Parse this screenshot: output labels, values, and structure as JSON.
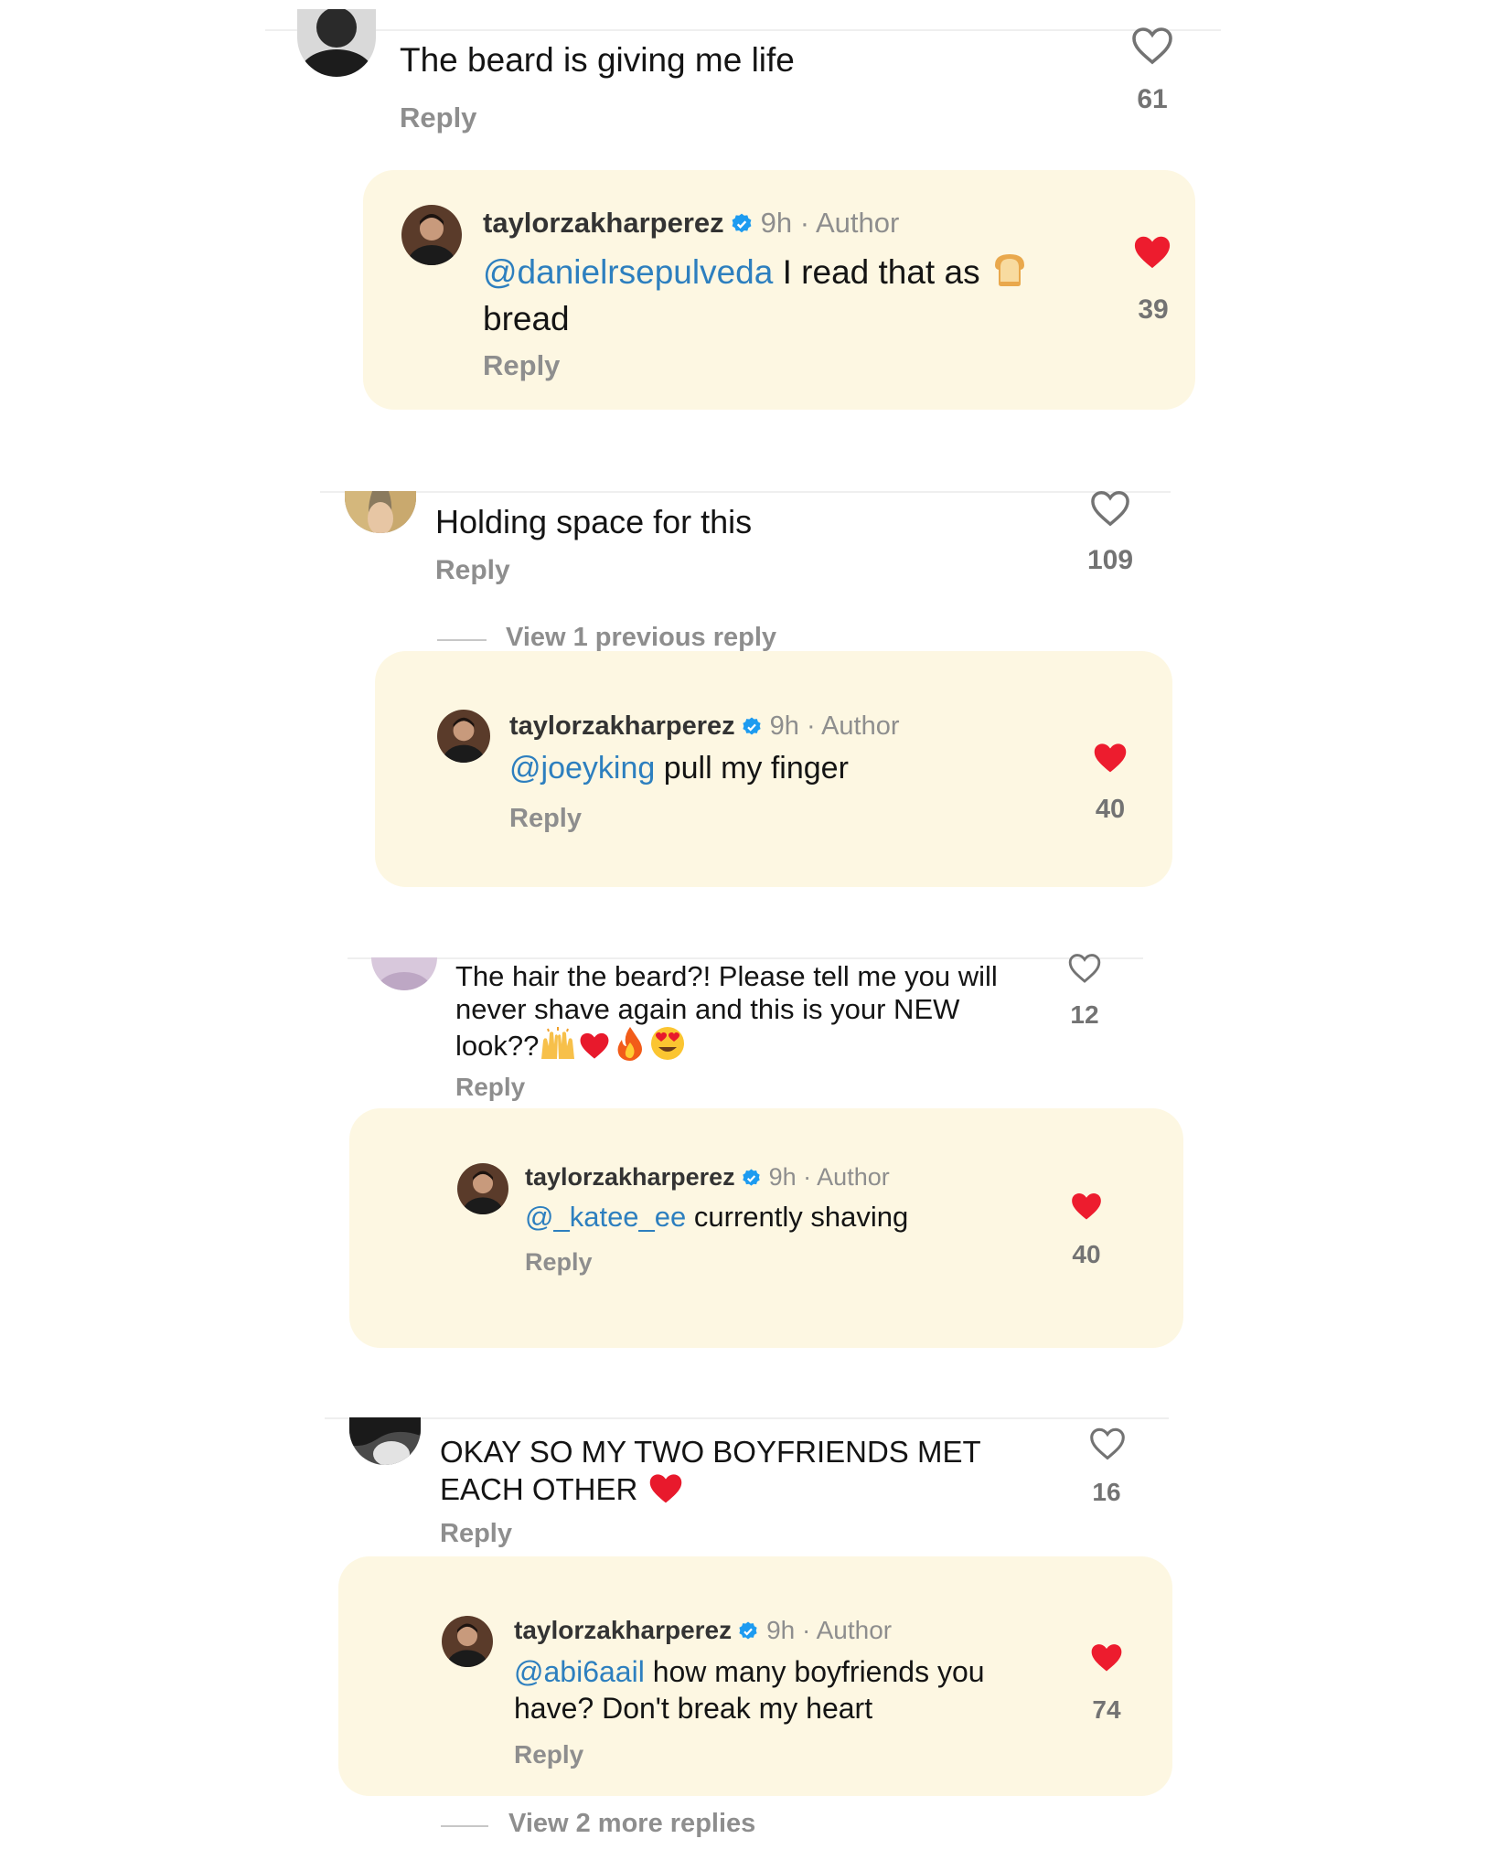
{
  "reply_label": "Reply",
  "colors": {
    "panel_bg": "#fdf7e2",
    "mention": "#2d7fbf",
    "liked_heart": "#ed1c2e",
    "verified": "#1d9bf0"
  },
  "threads": [
    {
      "comment": {
        "text": "The beard is giving me life",
        "likes": "61",
        "liked": false
      },
      "author_reply": {
        "username": "taylorzakharperez",
        "time": "9h",
        "role": "Author",
        "mention": "@danielrsepulveda",
        "text_line1": " I read that as ",
        "text_line2": "bread",
        "emoji": "bread-emoji",
        "likes": "39",
        "liked": true
      }
    },
    {
      "comment": {
        "text": "Holding space for this",
        "likes": "109",
        "liked": false
      },
      "view_previous": "View 1 previous reply",
      "author_reply": {
        "username": "taylorzakharperez",
        "time": "9h",
        "role": "Author",
        "mention": "@joeyking",
        "text": " pull my finger",
        "likes": "40",
        "liked": true
      }
    },
    {
      "comment": {
        "line1": "The hair the beard?! Please tell me you will",
        "line2": "never shave again and this is your NEW",
        "line3": "look??",
        "emojis": [
          "raising-hands-emoji",
          "red-heart-emoji",
          "fire-emoji",
          "heart-eyes-emoji"
        ],
        "likes": "12",
        "liked": false
      },
      "author_reply": {
        "username": "taylorzakharperez",
        "time": "9h",
        "role": "Author",
        "mention": "@_katee_ee",
        "text": " currently shaving",
        "likes": "40",
        "liked": true
      }
    },
    {
      "comment": {
        "line1": "OKAY SO MY TWO BOYFRIENDS MET",
        "line2": "EACH OTHER",
        "emoji": "red-heart-emoji",
        "likes": "16",
        "liked": false
      },
      "author_reply": {
        "username": "taylorzakharperez",
        "time": "9h",
        "role": "Author",
        "mention": "@abi6aail",
        "text_line1": " how many boyfriends you",
        "text_line2": "have? Don't break my heart",
        "likes": "74",
        "liked": true
      },
      "view_more": "View 2 more replies"
    }
  ]
}
